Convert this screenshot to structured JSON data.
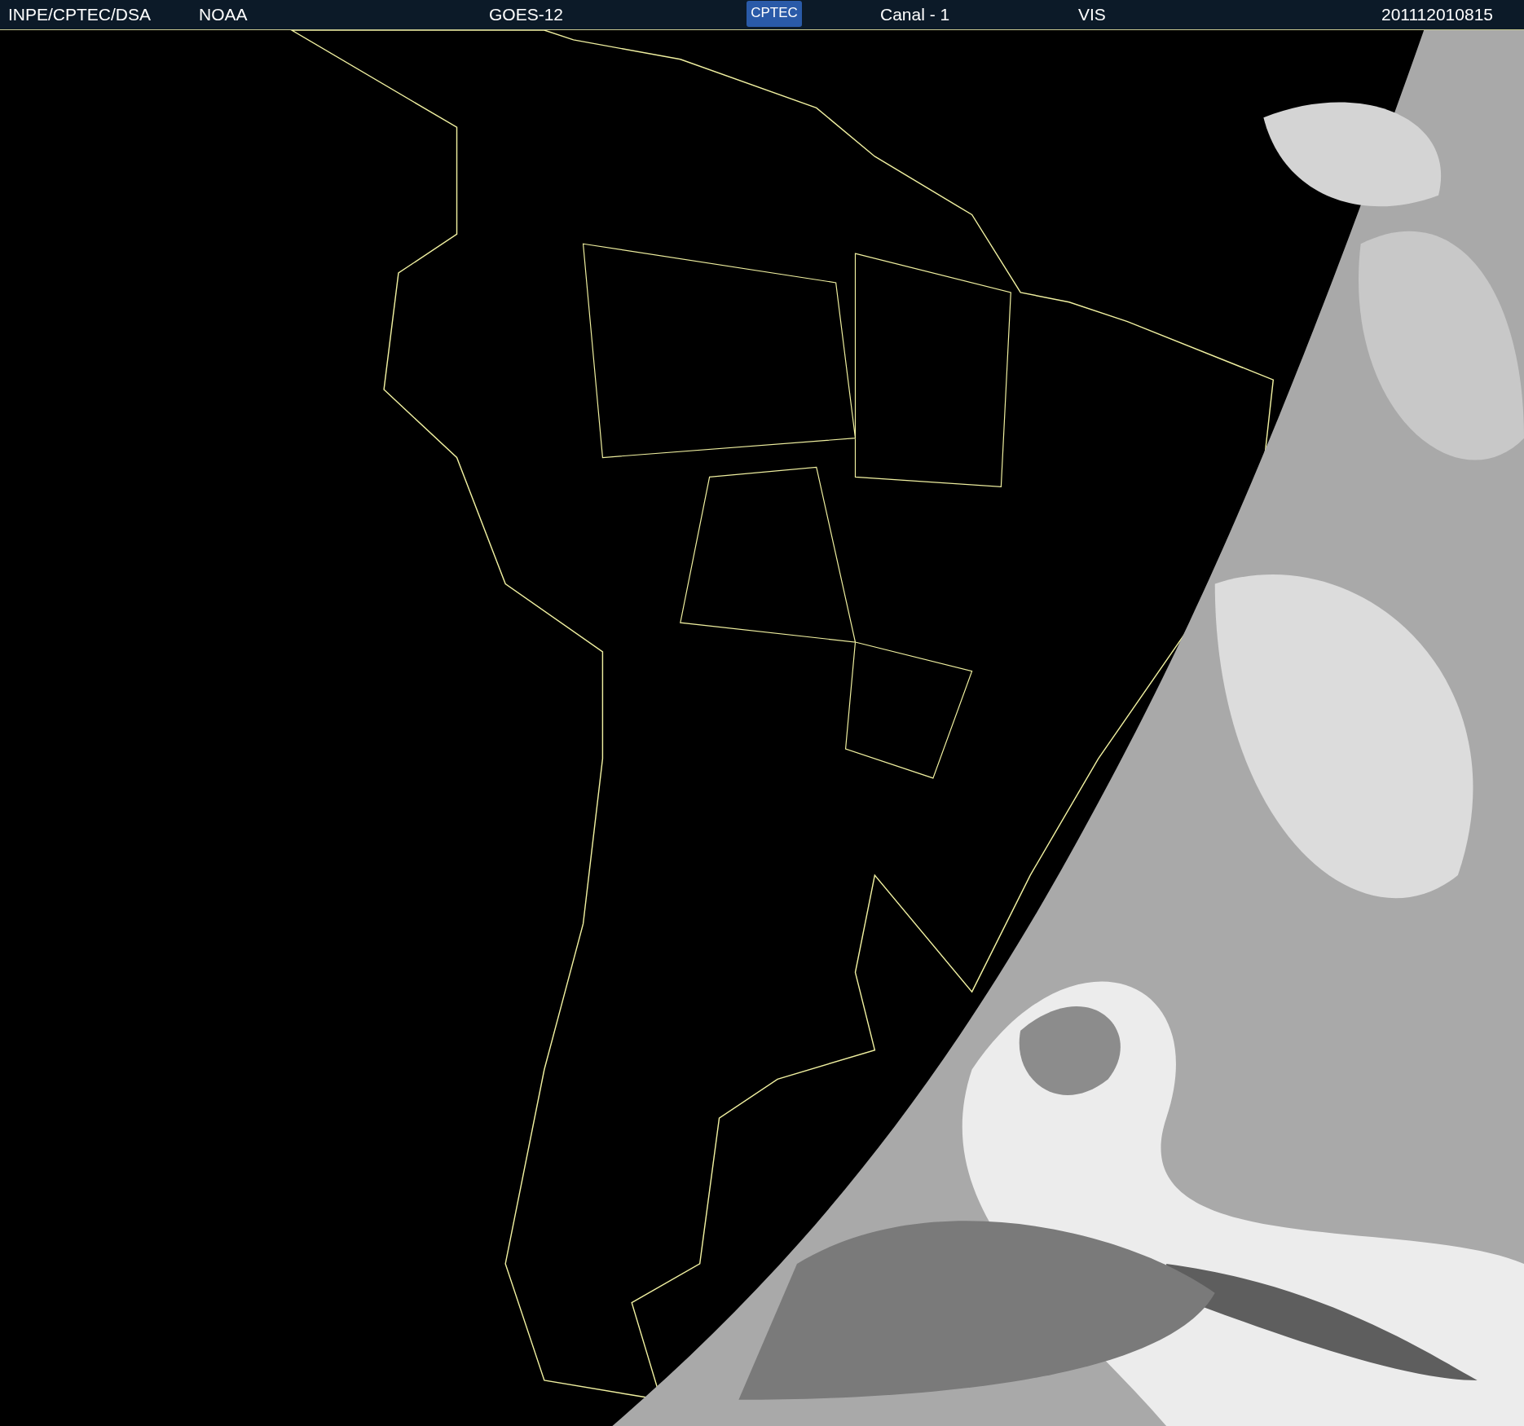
{
  "header": {
    "items": [
      {
        "kind": "text",
        "text": "INPE/CPTEC/DSA"
      },
      {
        "kind": "text",
        "text": "NOAA"
      },
      {
        "kind": "text",
        "text": "GOES-12"
      },
      {
        "kind": "logo",
        "text": "CPTEC"
      },
      {
        "kind": "text",
        "text": "Canal - 1"
      },
      {
        "kind": "text",
        "text": "VIS"
      },
      {
        "kind": "text",
        "text": "201112010815"
      }
    ]
  }
}
